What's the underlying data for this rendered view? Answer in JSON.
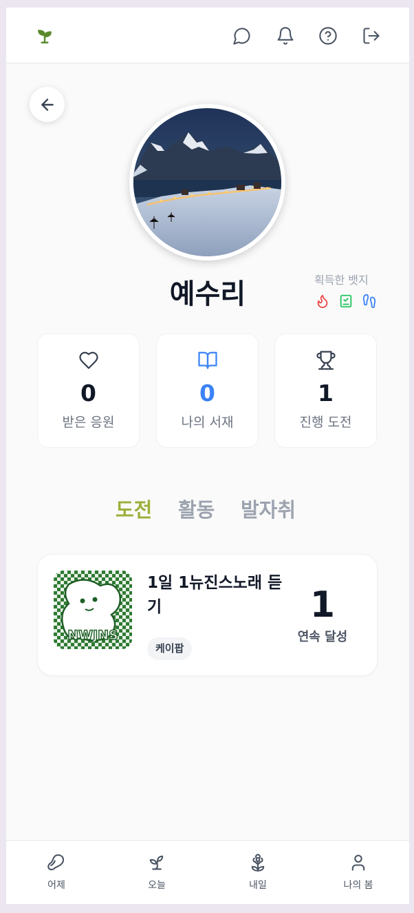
{
  "header": {
    "logo_icon": "sprout-icon",
    "actions": [
      {
        "icon": "chat-bubble-icon"
      },
      {
        "icon": "bell-icon"
      },
      {
        "icon": "help-circle-icon"
      },
      {
        "icon": "logout-icon"
      }
    ]
  },
  "profile": {
    "name": "예수리",
    "avatar_icon": "mountain-village-photo",
    "badges_label": "획득한 뱃지",
    "badges": [
      {
        "icon": "flame-icon",
        "color": "#ef4444"
      },
      {
        "icon": "clipboard-check-icon",
        "color": "#22c55e"
      },
      {
        "icon": "footprints-icon",
        "color": "#3b82f6"
      }
    ]
  },
  "stats": [
    {
      "icon": "heart-icon",
      "value": "0",
      "label": "받은 응원"
    },
    {
      "icon": "book-open-icon",
      "value": "0",
      "label": "나의 서재",
      "accent": "#3b82f6"
    },
    {
      "icon": "trophy-icon",
      "value": "1",
      "label": "진행 도전"
    }
  ],
  "tabs": [
    {
      "label": "도전",
      "active": true
    },
    {
      "label": "활동",
      "active": false
    },
    {
      "label": "발자취",
      "active": false
    }
  ],
  "challenge": {
    "title": "1일 1뉴진스노래 듣기",
    "tag": "케이팝",
    "streak_value": "1",
    "streak_label": "연속 달성",
    "thumb_text": "NWJNS"
  },
  "bottom_nav": [
    {
      "icon": "bean-icon",
      "label": "어제"
    },
    {
      "icon": "sprout-icon",
      "label": "오늘"
    },
    {
      "icon": "flower-icon",
      "label": "내일"
    },
    {
      "icon": "user-icon",
      "label": "나의 봄"
    }
  ],
  "colors": {
    "accent_green": "#9bb03a",
    "logo_green": "#5a8a2a",
    "stat_blue": "#3b82f6"
  }
}
